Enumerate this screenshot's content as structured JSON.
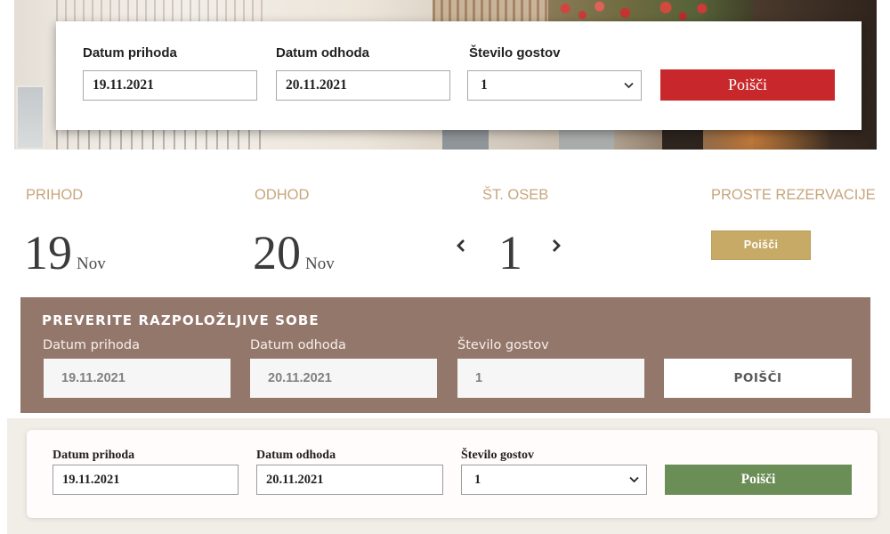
{
  "hero": {
    "arrival": {
      "label": "Datum prihoda",
      "value": "19.11.2021"
    },
    "departure": {
      "label": "Datum odhoda",
      "value": "20.11.2021"
    },
    "guests": {
      "label": "Število gostov",
      "value": "1",
      "dropdown_icon": "chevron-down-icon"
    },
    "search_label": "Poišči",
    "button_color": "#c8282c"
  },
  "summary": {
    "accent_color": "#c7a67d",
    "arrival": {
      "heading": "PRIHOD",
      "day": "19",
      "month": "Nov"
    },
    "departure": {
      "heading": "ODHOD",
      "day": "20",
      "month": "Nov"
    },
    "guests": {
      "heading": "ŠT. OSEB",
      "value": "1",
      "decrement_icon": "chevron-left-icon",
      "increment_icon": "chevron-right-icon"
    },
    "availability": {
      "heading": "PROSTE REZERVACIJE",
      "search_label": "Poišči"
    },
    "button_color": "#c7aa66"
  },
  "panel": {
    "background_color": "#94776b",
    "title": "PREVERITE RAZPOLOŽLJIVE SOBE",
    "arrival": {
      "label": "Datum prihoda",
      "value": "19.11.2021"
    },
    "departure": {
      "label": "Datum odhoda",
      "value": "20.11.2021"
    },
    "guests": {
      "label": "Število gostov",
      "value": "1"
    },
    "search_label": "POIŠČI"
  },
  "card": {
    "arrival": {
      "label": "Datum prihoda",
      "value": "19.11.2021"
    },
    "departure": {
      "label": "Datum odhoda",
      "value": "20.11.2021"
    },
    "guests": {
      "label": "Število gostov",
      "value": "1",
      "dropdown_icon": "chevron-down-icon"
    },
    "search_label": "Poišči",
    "button_color": "#6b8e57"
  }
}
